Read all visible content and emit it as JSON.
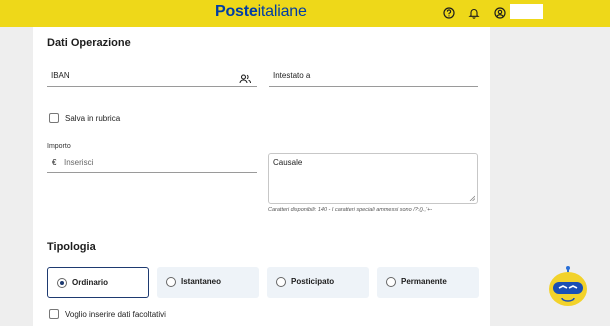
{
  "header": {
    "brand_bold": "Poste",
    "brand_regular": "italiane"
  },
  "form": {
    "section_title": "Dati Operazione",
    "iban_label": "IBAN",
    "intestato_label": "Intestato a",
    "save_label": "Salva in rubrica",
    "importo_label": "Importo",
    "currency_symbol": "€",
    "amount_placeholder": "Inserisci",
    "causale_label": "Causale",
    "causale_note": "Caratteri disponibili: 140 - I caratteri speciali ammessi sono /?:().,'+-"
  },
  "tipologia": {
    "title": "Tipologia",
    "options": [
      {
        "label": "Ordinario",
        "selected": true
      },
      {
        "label": "Istantaneo",
        "selected": false
      },
      {
        "label": "Posticipato",
        "selected": false
      },
      {
        "label": "Permanente",
        "selected": false
      }
    ],
    "optional_label": "Voglio inserire dati facoltativi"
  },
  "icons": {
    "help": "help-icon",
    "notifications": "bell-icon",
    "account": "user-icon",
    "contacts": "contacts-icon",
    "assistant": "assistant-mascot-icon"
  },
  "colors": {
    "brand_yellow": "#eed819",
    "brand_blue": "#003da5",
    "selected_border": "#1e3a70"
  }
}
